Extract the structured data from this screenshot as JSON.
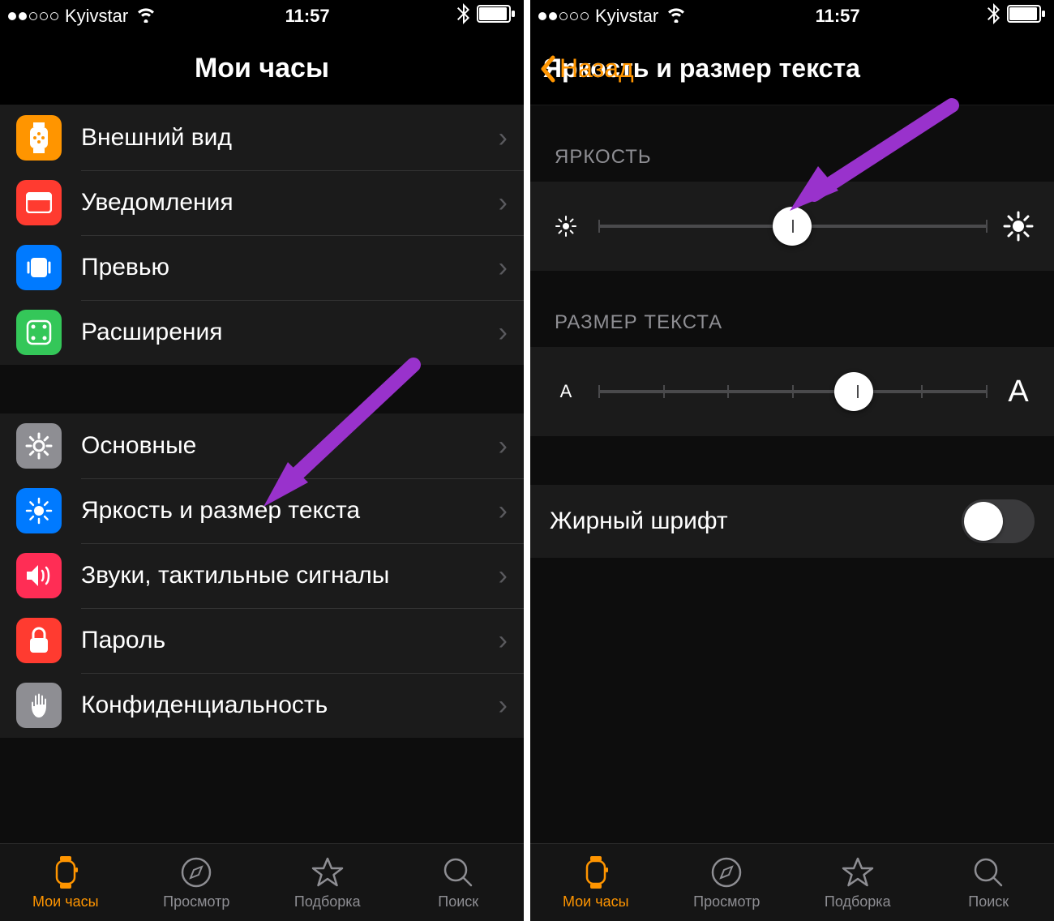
{
  "status": {
    "carrier": "Kyivstar",
    "time": "11:57",
    "signal_dots_filled": 2,
    "signal_dots_total": 5
  },
  "left_screen": {
    "title": "Мои часы",
    "groups": [
      {
        "items": [
          {
            "id": "appearance",
            "label": "Внешний вид",
            "icon": "watch-face-icon",
            "color": "#ff9500"
          },
          {
            "id": "notifications",
            "label": "Уведомления",
            "icon": "notification-tray-icon",
            "color": "#ff3b30"
          },
          {
            "id": "glances",
            "label": "Превью",
            "icon": "glance-icon",
            "color": "#007aff"
          },
          {
            "id": "complications",
            "label": "Расширения",
            "icon": "complication-icon",
            "color": "#34c759"
          }
        ]
      },
      {
        "items": [
          {
            "id": "general",
            "label": "Основные",
            "icon": "gear-icon",
            "color": "#8e8e93"
          },
          {
            "id": "brightness",
            "label": "Яркость и размер текста",
            "icon": "brightness-icon",
            "color": "#007aff"
          },
          {
            "id": "sounds",
            "label": "Звуки, тактильные сигналы",
            "icon": "sound-icon",
            "color": "#ff2d55"
          },
          {
            "id": "passcode",
            "label": "Пароль",
            "icon": "lock-icon",
            "color": "#ff3b30"
          },
          {
            "id": "privacy",
            "label": "Конфиденциальность",
            "icon": "hand-icon",
            "color": "#8e8e93"
          }
        ]
      }
    ]
  },
  "right_screen": {
    "back_label": "Назад",
    "title": "Яркость и размер текста",
    "brightness_header": "ЯРКОСТЬ",
    "brightness_value": 50,
    "brightness_ticks": 3,
    "textsize_header": "РАЗМЕР ТЕКСТА",
    "textsize_value": 66,
    "textsize_ticks": 7,
    "textsize_min_label": "А",
    "textsize_max_label": "А",
    "bold_label": "Жирный шрифт",
    "bold_on": false
  },
  "tabs": [
    {
      "id": "mywatch",
      "label": "Мои часы",
      "icon": "watch-icon"
    },
    {
      "id": "browse",
      "label": "Просмотр",
      "icon": "compass-icon"
    },
    {
      "id": "featured",
      "label": "Подборка",
      "icon": "star-icon"
    },
    {
      "id": "search",
      "label": "Поиск",
      "icon": "search-icon"
    }
  ],
  "colors": {
    "accent": "#ff9500",
    "arrow": "#9932cc"
  }
}
